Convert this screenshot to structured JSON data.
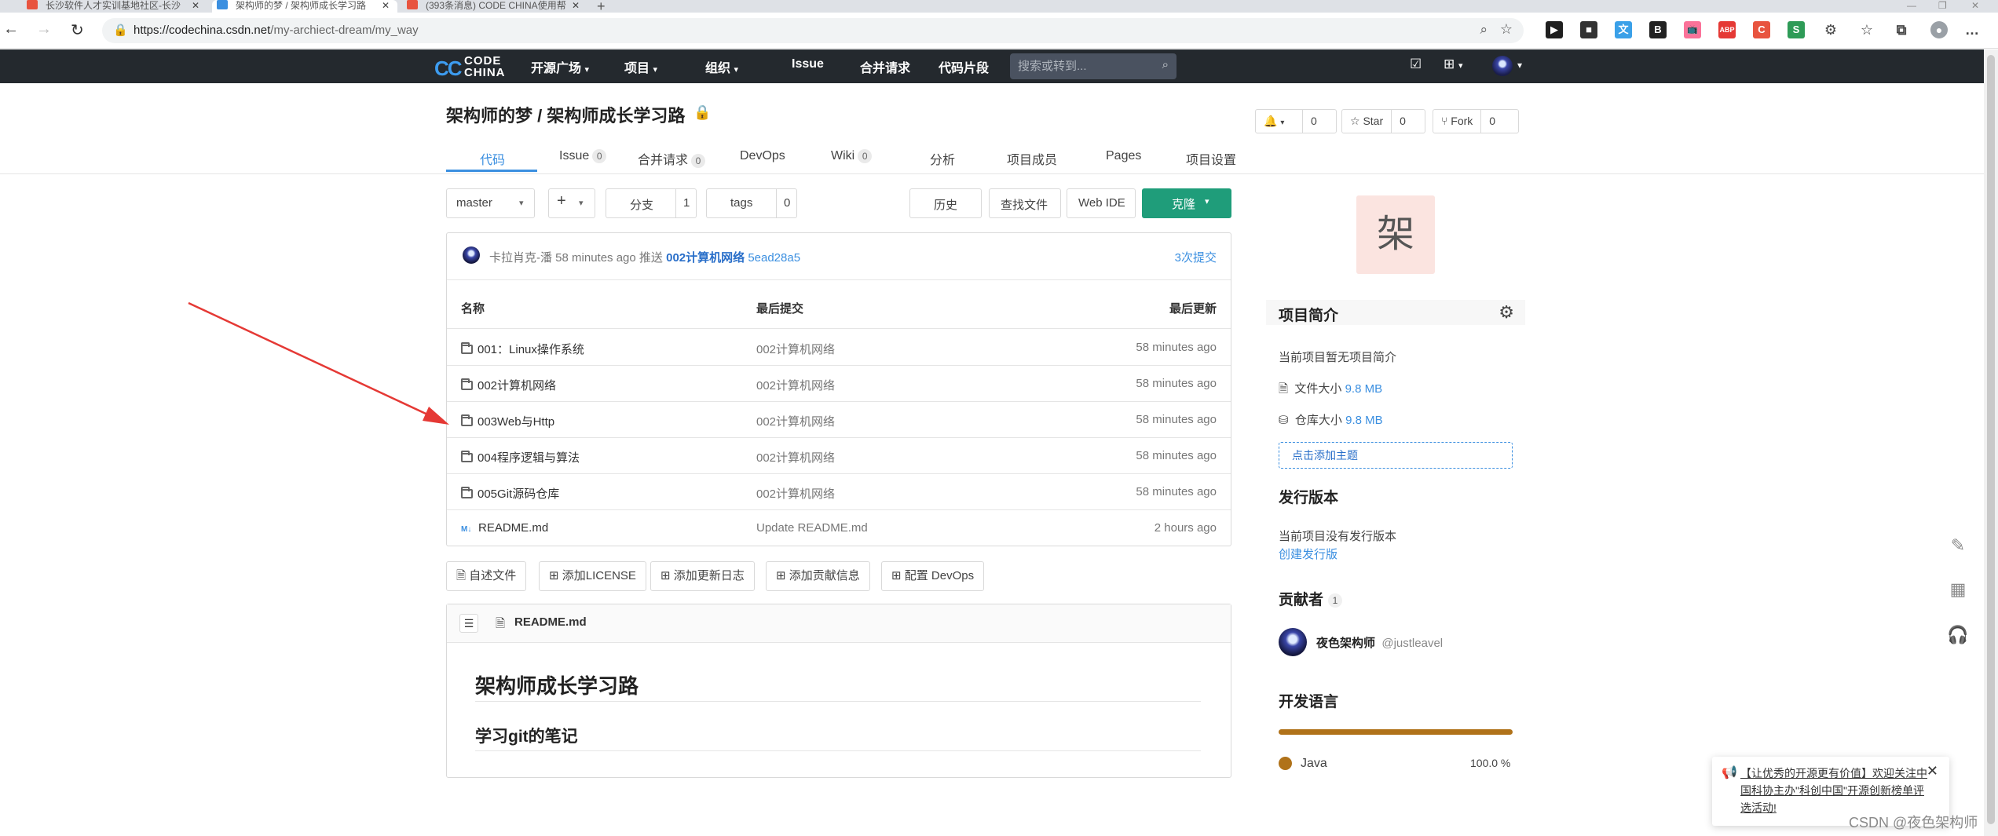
{
  "browser": {
    "tabs": [
      {
        "title": "长沙软件人才实训基地社区-长沙",
        "active": false,
        "color": "#e8543f"
      },
      {
        "title": "架构师的梦 / 架构师成长学习路",
        "active": true,
        "color": "#3b8fe0"
      },
      {
        "title": "(393条消息) CODE CHINA使用帮",
        "active": false,
        "color": "#e8543f"
      }
    ],
    "new_tab": "+",
    "url_host": "https://codechina.csdn.net",
    "url_path": "/my-archiect-dream/my_way",
    "extensions": [
      {
        "name": "video-ext",
        "label": "▶",
        "color": "#1f1f1f"
      },
      {
        "name": "box-ext",
        "label": "■",
        "color": "#333333"
      },
      {
        "name": "translate-ext",
        "label": "文",
        "color": "#3aa0e8"
      },
      {
        "name": "book-ext",
        "label": "B",
        "color": "#222222"
      },
      {
        "name": "bili-ext",
        "label": "📺",
        "color": "#fb7299"
      },
      {
        "name": "adblock-ext",
        "label": "ABP",
        "color": "#e53935"
      },
      {
        "name": "csdn-ext",
        "label": "C",
        "color": "#e8543f"
      },
      {
        "name": "sheet-ext",
        "label": "S",
        "color": "#2e9b57"
      }
    ]
  },
  "header": {
    "logo_line1": "CODE",
    "logo_line2": "CHINA",
    "nav": [
      {
        "label": "开源广场",
        "dropdown": true
      },
      {
        "label": "项目",
        "dropdown": true
      },
      {
        "label": "组织",
        "dropdown": true
      },
      {
        "label": "Issue",
        "dropdown": false
      },
      {
        "label": "合并请求",
        "dropdown": false
      },
      {
        "label": "代码片段",
        "dropdown": false
      }
    ],
    "search_placeholder": "搜索或转到..."
  },
  "project": {
    "title": "架构师的梦 / 架构师成长学习路",
    "notify_count": "0",
    "star_label": "Star",
    "star_count": "0",
    "fork_label": "Fork",
    "fork_count": "0",
    "tabs": [
      {
        "label": "代码",
        "badge": null,
        "active": true
      },
      {
        "label": "Issue",
        "badge": "0",
        "active": false
      },
      {
        "label": "合并请求",
        "badge": "0",
        "active": false
      },
      {
        "label": "DevOps",
        "badge": null,
        "active": false
      },
      {
        "label": "Wiki",
        "badge": "0",
        "active": false
      },
      {
        "label": "分析",
        "badge": null,
        "active": false
      },
      {
        "label": "项目成员",
        "badge": null,
        "active": false
      },
      {
        "label": "Pages",
        "badge": null,
        "active": false
      },
      {
        "label": "项目设置",
        "badge": null,
        "active": false
      }
    ]
  },
  "toolbar": {
    "branch": "master",
    "add": "+",
    "branches_label": "分支",
    "branches_count": "1",
    "tags_label": "tags",
    "tags_count": "0",
    "history": "历史",
    "find_file": "查找文件",
    "web_ide": "Web IDE",
    "clone": "克隆"
  },
  "last_commit": {
    "author": "卡拉肖克-潘",
    "time": "58 minutes ago",
    "action": "推送",
    "message": "002计算机网络",
    "hash": "5ead28a5",
    "count": "3次提交"
  },
  "file_table": {
    "columns": [
      "名称",
      "最后提交",
      "最后更新"
    ],
    "rows": [
      {
        "type": "folder",
        "name": "001：Linux操作系统",
        "commit": "002计算机网络",
        "updated": "58 minutes ago"
      },
      {
        "type": "folder",
        "name": "002计算机网络",
        "commit": "002计算机网络",
        "updated": "58 minutes ago"
      },
      {
        "type": "folder",
        "name": "003Web与Http",
        "commit": "002计算机网络",
        "updated": "58 minutes ago"
      },
      {
        "type": "folder",
        "name": "004程序逻辑与算法",
        "commit": "002计算机网络",
        "updated": "58 minutes ago"
      },
      {
        "type": "folder",
        "name": "005Git源码仓库",
        "commit": "002计算机网络",
        "updated": "58 minutes ago"
      },
      {
        "type": "markdown",
        "name": "README.md",
        "commit": "Update README.md",
        "updated": "2 hours ago"
      }
    ]
  },
  "add_buttons": [
    "自述文件",
    "添加LICENSE",
    "添加更新日志",
    "添加贡献信息",
    "配置 DevOps"
  ],
  "readme": {
    "filename": "README.md",
    "h1": "架构师成长学习路",
    "h2": "学习git的笔记"
  },
  "sidebar": {
    "avatar_char": "架",
    "intro_title": "项目简介",
    "no_intro": "当前项目暂无项目简介",
    "file_size_label": "文件大小",
    "file_size": "9.8 MB",
    "repo_size_label": "仓库大小",
    "repo_size": "9.8 MB",
    "add_topic": "点击添加主题",
    "release_title": "发行版本",
    "no_release": "当前项目没有发行版本",
    "create_release": "创建发行版",
    "contributors_title": "贡献者",
    "contributors_count": "1",
    "contributor_name": "夜色架构师",
    "contributor_handle": "@justleavel",
    "language_title": "开发语言",
    "language": "Java",
    "language_pct": "100.0 %",
    "language_color": "#b07219"
  },
  "notice": {
    "text": "【让优秀的开源更有价值】欢迎关注中国科协主办\"科创中国\"开源创新榜单评选活动!"
  },
  "watermark": "CSDN @夜色架构师"
}
